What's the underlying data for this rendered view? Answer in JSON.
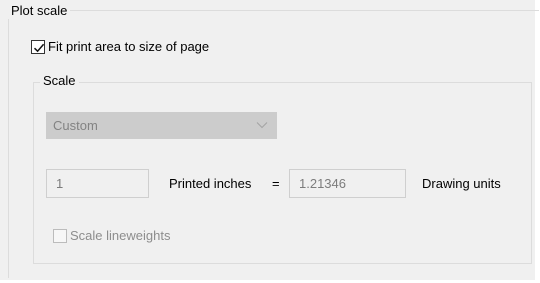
{
  "plot_scale": {
    "legend": "Plot scale",
    "fit_checkbox": {
      "label": "Fit print area to size of page",
      "checked": true
    }
  },
  "scale": {
    "legend": "Scale",
    "dropdown": {
      "value": "Custom",
      "enabled": false
    },
    "printed_value": "1",
    "printed_label": "Printed inches",
    "equals": "=",
    "drawing_value": "1.21346",
    "drawing_label": "Drawing units",
    "lineweights_checkbox": {
      "label": "Scale lineweights",
      "checked": false,
      "enabled": false
    }
  },
  "colors": {
    "panel_bg": "#f0f0f0",
    "disabled_text": "#838383",
    "dropdown_bg": "#cccccc"
  },
  "icons": {
    "check": "check-icon",
    "chevron": "chevron-down-icon"
  }
}
